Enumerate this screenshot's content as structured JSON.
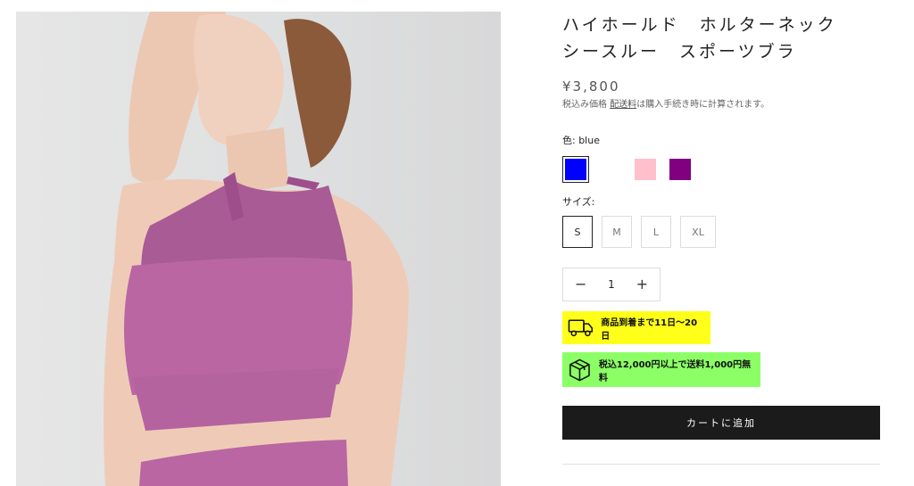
{
  "product": {
    "title_line1": "ハイホールド　ホルターネック",
    "title_line2": "シースルー　スポーツブラ",
    "price": "¥3,800",
    "tax_prefix": "税込み価格 ",
    "shipping_link": "配送料",
    "tax_suffix": "は購入手続き時に計算されます。"
  },
  "color": {
    "label": "色: blue",
    "swatches": [
      {
        "name": "blue",
        "hex": "#0000ff",
        "selected": true
      },
      {
        "name": "white",
        "hex": "#ffffff",
        "selected": false
      },
      {
        "name": "pink",
        "hex": "#ffc0cb",
        "selected": false
      },
      {
        "name": "purple",
        "hex": "#800080",
        "selected": false
      }
    ]
  },
  "size": {
    "label": "サイズ:",
    "options": [
      "S",
      "M",
      "L",
      "XL"
    ],
    "selected": "S"
  },
  "quantity": {
    "minus": "−",
    "value": "1",
    "plus": "+"
  },
  "badges": {
    "delivery": "商品到着まで11日〜20日",
    "shipping": "税込12,000円以上で送料1,000円無料",
    "delivery_color": "#ffff1a",
    "shipping_color": "#8cff66"
  },
  "cart": {
    "label": "カートに追加",
    "color": "#1b1b1b"
  }
}
